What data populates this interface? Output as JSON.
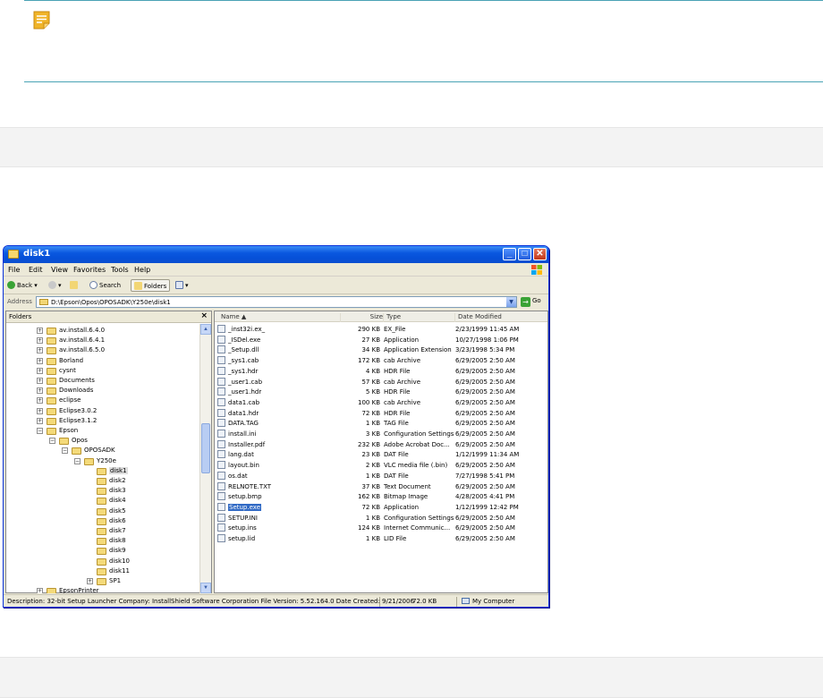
{
  "window": {
    "title": "disk1",
    "minimize_glyph": "_",
    "maximize_glyph": "□",
    "close_glyph": "✕"
  },
  "menu": [
    "File",
    "Edit",
    "View",
    "Favorites",
    "Tools",
    "Help"
  ],
  "toolbar": {
    "back_label": "Back",
    "search_label": "Search",
    "folders_label": "Folders"
  },
  "address": {
    "label": "Address",
    "path": "D:\\Epson\\Opos\\OPOSADK\\Y250e\\disk1",
    "go_label": "Go"
  },
  "folders_pane": {
    "title": "Folders",
    "close_glyph": "×",
    "items": [
      {
        "label": "av.install.6.4.0",
        "expander": "+"
      },
      {
        "label": "av.install.6.4.1",
        "expander": "+"
      },
      {
        "label": "av.install.6.5.0",
        "expander": "+"
      },
      {
        "label": "Borland",
        "expander": "+"
      },
      {
        "label": "cysnt",
        "expander": "+"
      },
      {
        "label": "Documents",
        "expander": "+"
      },
      {
        "label": "Downloads",
        "expander": "+"
      },
      {
        "label": "eclipse",
        "expander": "+"
      },
      {
        "label": "Eclipse3.0.2",
        "expander": "+"
      },
      {
        "label": "Eclipse3.1.2",
        "expander": "+"
      },
      {
        "label": "Epson",
        "expander": "−"
      },
      {
        "label": "Opos",
        "expander": "−"
      },
      {
        "label": "OPOSADK",
        "expander": "−"
      },
      {
        "label": "Y250e",
        "expander": "−"
      },
      {
        "label": "disk1",
        "expander": ""
      },
      {
        "label": "disk2",
        "expander": ""
      },
      {
        "label": "disk3",
        "expander": ""
      },
      {
        "label": "disk4",
        "expander": ""
      },
      {
        "label": "disk5",
        "expander": ""
      },
      {
        "label": "disk6",
        "expander": ""
      },
      {
        "label": "disk7",
        "expander": ""
      },
      {
        "label": "disk8",
        "expander": ""
      },
      {
        "label": "disk9",
        "expander": ""
      },
      {
        "label": "disk10",
        "expander": ""
      },
      {
        "label": "disk11",
        "expander": ""
      },
      {
        "label": "SP1",
        "expander": "+"
      },
      {
        "label": "EpsonPrinter",
        "expander": "+"
      }
    ]
  },
  "files": {
    "columns": [
      "Name",
      "Size",
      "Type",
      "Date Modified"
    ],
    "rows": [
      {
        "name": "_inst32i.ex_",
        "size": "290 KB",
        "type": "EX_File",
        "date": "2/23/1999 11:45 AM"
      },
      {
        "name": "_ISDel.exe",
        "size": "27 KB",
        "type": "Application",
        "date": "10/27/1998 1:06 PM"
      },
      {
        "name": "_Setup.dll",
        "size": "34 KB",
        "type": "Application Extension",
        "date": "3/23/1998 5:34 PM"
      },
      {
        "name": "_sys1.cab",
        "size": "172 KB",
        "type": "cab Archive",
        "date": "6/29/2005 2:50 AM"
      },
      {
        "name": "_sys1.hdr",
        "size": "4 KB",
        "type": "HDR File",
        "date": "6/29/2005 2:50 AM"
      },
      {
        "name": "_user1.cab",
        "size": "57 KB",
        "type": "cab Archive",
        "date": "6/29/2005 2:50 AM"
      },
      {
        "name": "_user1.hdr",
        "size": "5 KB",
        "type": "HDR File",
        "date": "6/29/2005 2:50 AM"
      },
      {
        "name": "data1.cab",
        "size": "100 KB",
        "type": "cab Archive",
        "date": "6/29/2005 2:50 AM"
      },
      {
        "name": "data1.hdr",
        "size": "72 KB",
        "type": "HDR File",
        "date": "6/29/2005 2:50 AM"
      },
      {
        "name": "DATA.TAG",
        "size": "1 KB",
        "type": "TAG File",
        "date": "6/29/2005 2:50 AM"
      },
      {
        "name": "install.ini",
        "size": "3 KB",
        "type": "Configuration Settings",
        "date": "6/29/2005 2:50 AM"
      },
      {
        "name": "Installer.pdf",
        "size": "232 KB",
        "type": "Adobe Acrobat Doc...",
        "date": "6/29/2005 2:50 AM"
      },
      {
        "name": "lang.dat",
        "size": "23 KB",
        "type": "DAT File",
        "date": "1/12/1999 11:34 AM"
      },
      {
        "name": "layout.bin",
        "size": "2 KB",
        "type": "VLC media file (.bin)",
        "date": "6/29/2005 2:50 AM"
      },
      {
        "name": "os.dat",
        "size": "1 KB",
        "type": "DAT File",
        "date": "7/27/1998 5:41 PM"
      },
      {
        "name": "RELNOTE.TXT",
        "size": "37 KB",
        "type": "Text Document",
        "date": "6/29/2005 2:50 AM"
      },
      {
        "name": "setup.bmp",
        "size": "162 KB",
        "type": "Bitmap Image",
        "date": "4/28/2005 4:41 PM"
      },
      {
        "name": "Setup.exe",
        "size": "72 KB",
        "type": "Application",
        "date": "1/12/1999 12:42 PM",
        "selected": true
      },
      {
        "name": "SETUP.INI",
        "size": "1 KB",
        "type": "Configuration Settings",
        "date": "6/29/2005 2:50 AM"
      },
      {
        "name": "setup.ins",
        "size": "124 KB",
        "type": "Internet Communic...",
        "date": "6/29/2005 2:50 AM"
      },
      {
        "name": "setup.lid",
        "size": "1 KB",
        "type": "LID File",
        "date": "6/29/2005 2:50 AM"
      }
    ]
  },
  "status": {
    "description": "Description: 32-bit Setup Launcher Company: InstallShield Software Corporation File Version: 5.52.164.0 Date Created: 9/21/2006",
    "size": "72.0 KB",
    "location": "My Computer"
  },
  "colors": {
    "note_rule": "#4aa3b5",
    "note_icon": "#f0b429",
    "xp_title_blue": "#0a58e0",
    "selection": "#316ac5"
  }
}
